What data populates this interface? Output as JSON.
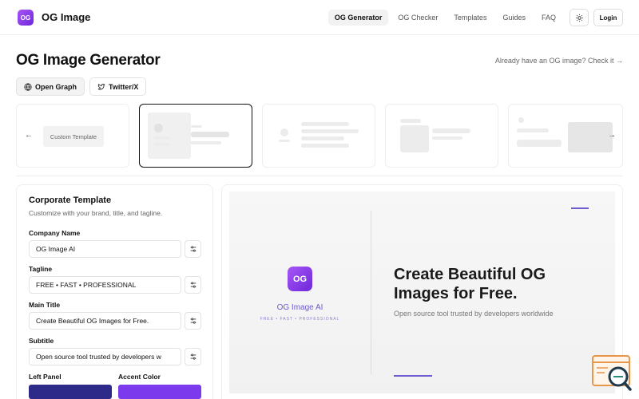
{
  "header": {
    "logo_text": "OG",
    "brand": "OG Image",
    "nav": [
      {
        "label": "OG Generator",
        "active": true
      },
      {
        "label": "OG Checker",
        "active": false
      },
      {
        "label": "Templates",
        "active": false
      },
      {
        "label": "Guides",
        "active": false
      },
      {
        "label": "FAQ",
        "active": false
      }
    ],
    "theme_icon": "sun-icon",
    "login_label": "Login"
  },
  "page": {
    "title": "OG Image Generator",
    "check_link": "Already have an OG image? Check it →"
  },
  "tabs": [
    {
      "label": "Open Graph",
      "icon": "globe-icon",
      "active": true
    },
    {
      "label": "Twitter/X",
      "icon": "bird-icon",
      "active": false
    }
  ],
  "templates": {
    "prev_icon": "←",
    "next_icon": "→",
    "custom_label": "Custom Template",
    "selected_index": 1
  },
  "form": {
    "title": "Corporate Template",
    "description": "Customize with your brand, title, and tagline.",
    "fields": [
      {
        "label": "Company Name",
        "value": "OG Image AI"
      },
      {
        "label": "Tagline",
        "value": "FREE • FAST • PROFESSIONAL"
      },
      {
        "label": "Main Title",
        "value": "Create Beautiful OG Images for Free."
      },
      {
        "label": "Subtitle",
        "value": "Open source tool trusted by developers w"
      }
    ],
    "left_panel_label": "Left Panel",
    "accent_color_label": "Accent Color",
    "left_panel_color": "#2d2a8a",
    "accent_color": "#7c3aed"
  },
  "preview": {
    "logo_text": "OG",
    "company": "OG Image AI",
    "tagline": "FREE • FAST • PROFESSIONAL",
    "title": "Create Beautiful OG Images for Free.",
    "subtitle": "Open source tool trusted by developers worldwide"
  }
}
